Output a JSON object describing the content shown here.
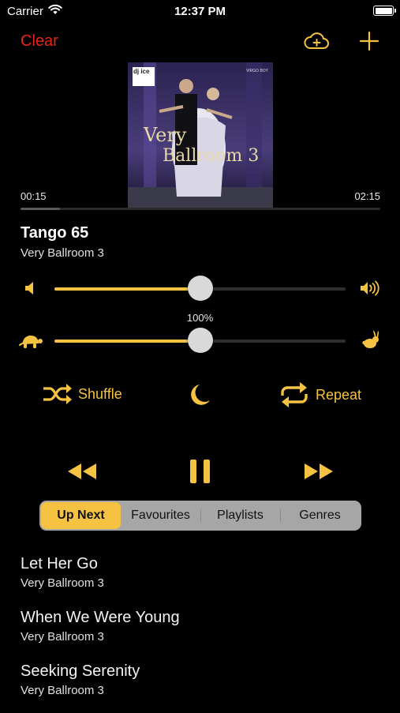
{
  "status_bar": {
    "carrier": "Carrier",
    "time": "12:37 PM"
  },
  "toolbar": {
    "clear_label": "Clear",
    "cloud_icon": "cloud-plus-icon",
    "add_icon": "plus-icon"
  },
  "artwork": {
    "dj": "dj ice",
    "label": "VIRGO BOY",
    "title_line1": "Very",
    "title_line2": "Ballroom 3"
  },
  "playback": {
    "elapsed": "00:15",
    "total": "02:15",
    "progress": 0.11
  },
  "now_playing": {
    "title": "Tango 65",
    "album": "Very Ballroom 3"
  },
  "volume": {
    "level": 0.5,
    "low_icon": "speaker-low-icon",
    "high_icon": "speaker-high-icon"
  },
  "speed": {
    "label": "100%",
    "level": 0.5,
    "slow_icon": "turtle-icon",
    "fast_icon": "rabbit-icon"
  },
  "controls": {
    "shuffle_label": "Shuffle",
    "repeat_label": "Repeat",
    "sleep_icon": "moon-icon",
    "rewind_icon": "rewind-icon",
    "pause_icon": "pause-icon",
    "forward_icon": "fast-forward-icon"
  },
  "tabs": [
    {
      "label": "Up Next",
      "active": true
    },
    {
      "label": "Favourites",
      "active": false
    },
    {
      "label": "Playlists",
      "active": false
    },
    {
      "label": "Genres",
      "active": false
    }
  ],
  "queue": [
    {
      "title": "Let Her Go",
      "album": "Very Ballroom 3"
    },
    {
      "title": "When We Were Young",
      "album": "Very Ballroom 3"
    },
    {
      "title": "Seeking Serenity",
      "album": "Very Ballroom 3"
    }
  ],
  "colors": {
    "accent": "#f5c242",
    "clear": "#e8231b",
    "tabs_bg": "#a6a6a6"
  }
}
